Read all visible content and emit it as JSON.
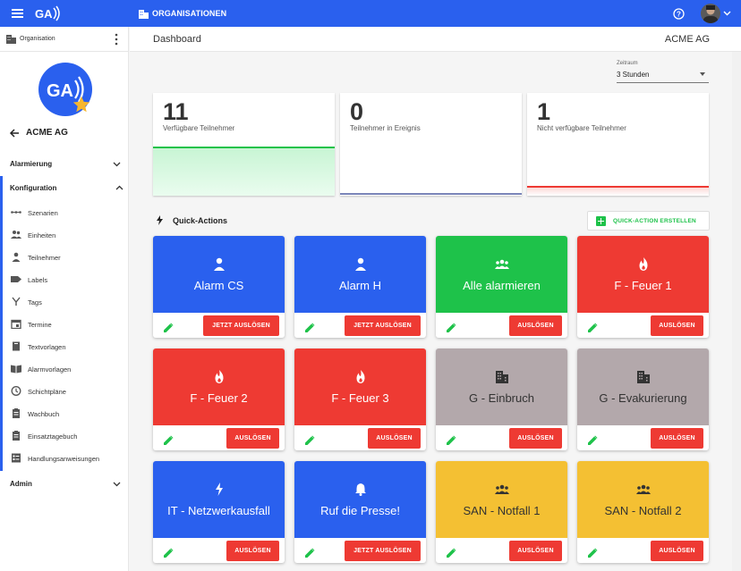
{
  "topbar": {
    "org_label": "ORGANISATIONEN",
    "brand_color": "#2a60ee"
  },
  "sidebar": {
    "org_label": "Organisation",
    "back_label": "ACME AG",
    "sections": [
      {
        "label": "Alarmierung",
        "expanded": false
      },
      {
        "label": "Konfiguration",
        "expanded": true
      },
      {
        "label": "Admin",
        "expanded": false
      }
    ],
    "items": [
      {
        "label": "Szenarien",
        "icon": "scenario-icon"
      },
      {
        "label": "Einheiten",
        "icon": "groups-icon"
      },
      {
        "label": "Teilnehmer",
        "icon": "person-icon"
      },
      {
        "label": "Labels",
        "icon": "label-icon"
      },
      {
        "label": "Tags",
        "icon": "tag-icon"
      },
      {
        "label": "Termine",
        "icon": "calendar-icon"
      },
      {
        "label": "Textvorlagen",
        "icon": "book-icon"
      },
      {
        "label": "Alarmvorlagen",
        "icon": "open-book-icon"
      },
      {
        "label": "Schichtpläne",
        "icon": "clock-icon"
      },
      {
        "label": "Wachbuch",
        "icon": "clipboard-icon"
      },
      {
        "label": "Einsatztagebuch",
        "icon": "clipboard-icon"
      },
      {
        "label": "Handlungsanweisungen",
        "icon": "list-icon"
      }
    ]
  },
  "header": {
    "title": "Dashboard",
    "company": "ACME AG"
  },
  "zeitraum": {
    "label": "Zeitraum",
    "value": "3 Stunden"
  },
  "stats": [
    {
      "value": "11",
      "label": "Verfügbare Teilnehmer",
      "color": "#1ec24a"
    },
    {
      "value": "0",
      "label": "Teilnehmer in Ereignis",
      "color": "#7a85b8"
    },
    {
      "value": "1",
      "label": "Nicht verfügbare Teilnehmer",
      "color": "#ee3a33"
    }
  ],
  "quick_actions": {
    "title": "Quick-Actions",
    "create_label": "QUICK-ACTION ERSTELLEN",
    "cards": [
      {
        "name": "Alarm CS",
        "icon": "person-icon",
        "color": "#2a60ee",
        "button": "JETZT AUSLÖSEN"
      },
      {
        "name": "Alarm H",
        "icon": "person-icon",
        "color": "#2a60ee",
        "button": "JETZT AUSLÖSEN"
      },
      {
        "name": "Alle alarmieren",
        "icon": "groups-icon",
        "color": "#1ec24a",
        "button": "AUSLÖSEN"
      },
      {
        "name": "F - Feuer 1",
        "icon": "fire-icon",
        "color": "#ee3a33",
        "button": "AUSLÖSEN"
      },
      {
        "name": "F - Feuer 2",
        "icon": "fire-icon",
        "color": "#ee3a33",
        "button": "AUSLÖSEN"
      },
      {
        "name": "F - Feuer 3",
        "icon": "fire-icon",
        "color": "#ee3a33",
        "button": "AUSLÖSEN"
      },
      {
        "name": "G - Einbruch",
        "icon": "building-icon",
        "color": "#b3a8ab",
        "button": "AUSLÖSEN"
      },
      {
        "name": "G - Evakurierung",
        "icon": "building-icon",
        "color": "#b3a8ab",
        "button": "AUSLÖSEN"
      },
      {
        "name": "IT - Netzwerkausfall",
        "icon": "bolt-icon",
        "color": "#2a60ee",
        "button": "AUSLÖSEN"
      },
      {
        "name": "Ruf die Presse!",
        "icon": "bell-icon",
        "color": "#2a60ee",
        "button": "JETZT AUSLÖSEN"
      },
      {
        "name": "SAN - Notfall 1",
        "icon": "groups-icon",
        "color": "#f4c033",
        "button": "AUSLÖSEN"
      },
      {
        "name": "SAN - Notfall 2",
        "icon": "groups-icon",
        "color": "#f4c033",
        "button": "AUSLÖSEN"
      }
    ]
  }
}
